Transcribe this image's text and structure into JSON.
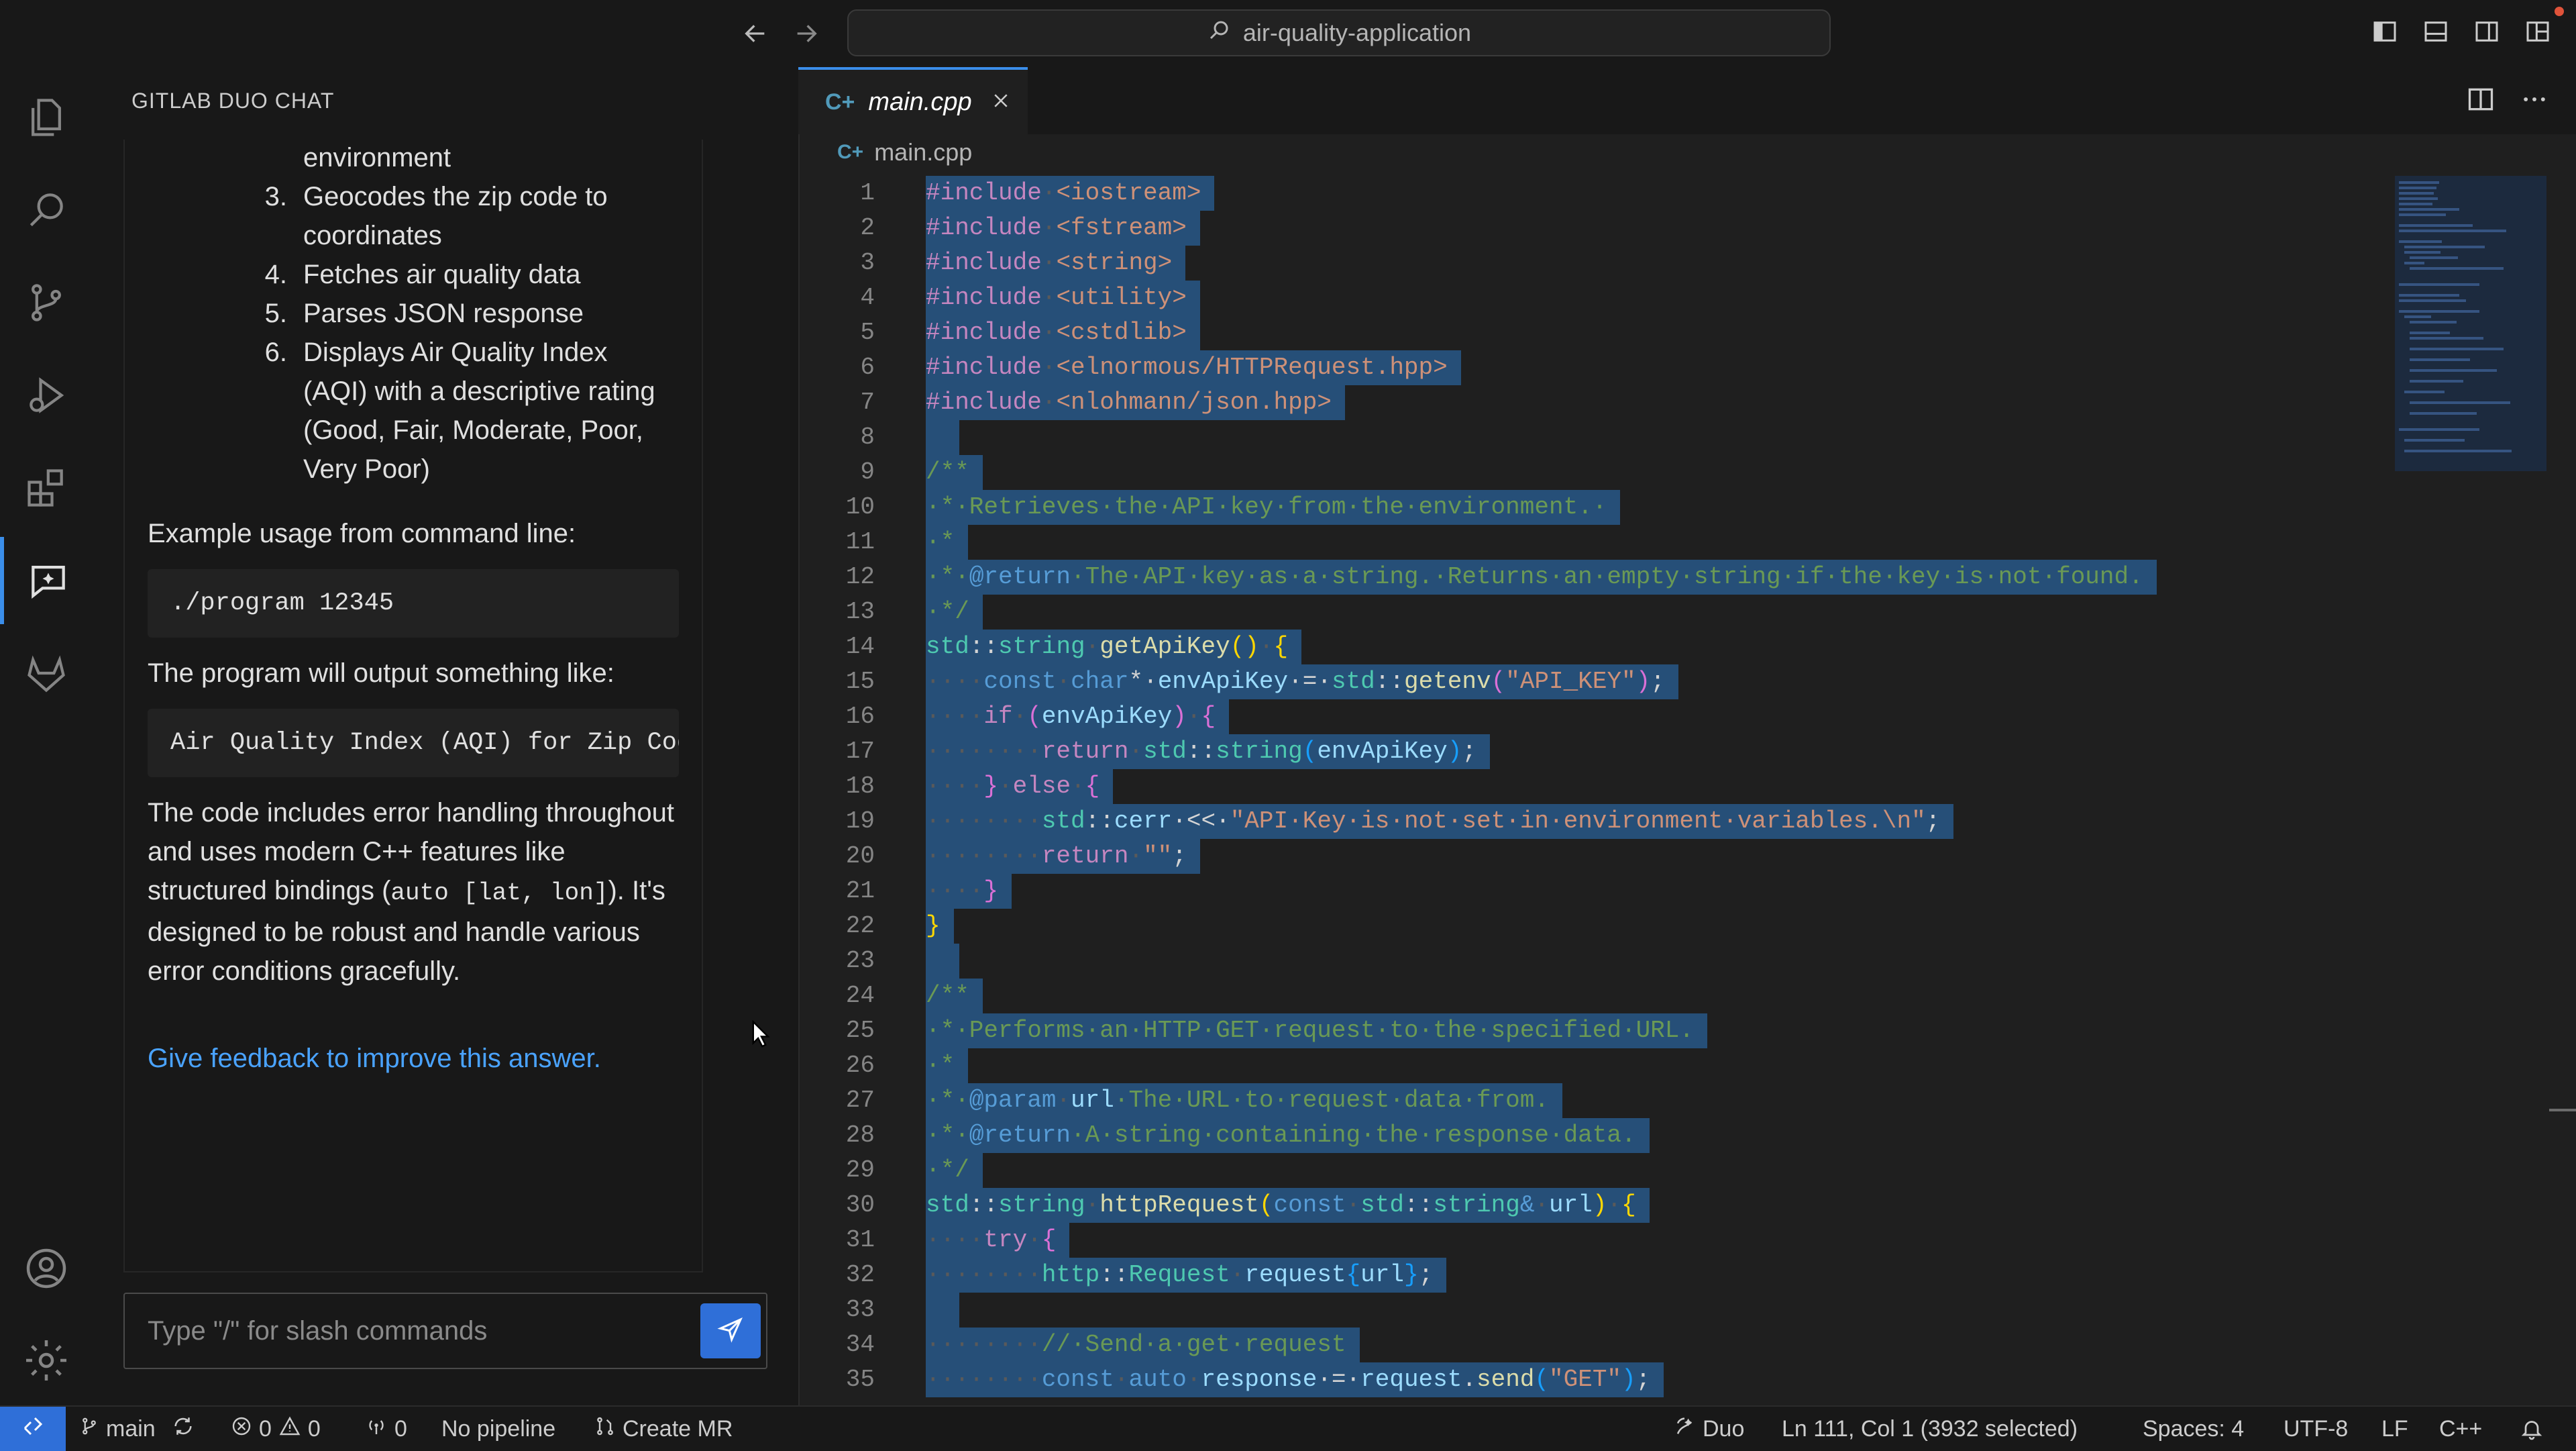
{
  "titlebar": {
    "search_text": "air-quality-application",
    "back": "back-arrow",
    "forward": "forward-arrow"
  },
  "activity_bar": {
    "items": [
      "explorer",
      "search",
      "source-control",
      "run-debug",
      "extensions",
      "gitlab-duo-chat",
      "gitlab"
    ],
    "bottom": [
      "accounts",
      "manage"
    ],
    "active": "gitlab-duo-chat"
  },
  "chat": {
    "title": "GITLAB DUO CHAT",
    "list_partial": "environment",
    "list_items": [
      {
        "num": "3.",
        "text": "Geocodes the zip code to coordinates"
      },
      {
        "num": "4.",
        "text": "Fetches air quality data"
      },
      {
        "num": "5.",
        "text": "Parses JSON response"
      },
      {
        "num": "6.",
        "text": "Displays Air Quality Index (AQI) with a descriptive rating (Good, Fair, Moderate, Poor, Very Poor)"
      }
    ],
    "usage_heading": "Example usage from command line:",
    "usage_code": "./program 12345",
    "output_heading": "The program will output something like:",
    "output_code": "Air Quality Index (AQI) for Zip Code",
    "summary_1": "The code includes error handling throughout and uses modern C++ features like structured bindings (",
    "summary_code": "auto [lat, lon]",
    "summary_2": "). It's designed to be robust and handle various error conditions gracefully.",
    "feedback_link": "Give feedback to improve this answer.",
    "input_placeholder": "Type \"/\" for slash commands"
  },
  "editor": {
    "tab_label": "main.cpp",
    "breadcrumb": "main.cpp",
    "line_numbers": [
      "1",
      "2",
      "3",
      "4",
      "5",
      "6",
      "7",
      "8",
      "9",
      "10",
      "11",
      "12",
      "13",
      "14",
      "15",
      "16",
      "17",
      "18",
      "19",
      "20",
      "21",
      "22",
      "23",
      "24",
      "25",
      "26",
      "27",
      "28",
      "29",
      "30",
      "31",
      "32",
      "33",
      "34",
      "35"
    ]
  },
  "statusbar": {
    "branch": "main",
    "errors": "0",
    "warnings": "0",
    "ports": "0",
    "pipeline": "No pipeline",
    "create_mr": "Create MR",
    "duo": "Duo",
    "position": "Ln 111, Col 1 (3932 selected)",
    "spaces": "Spaces: 4",
    "encoding": "UTF-8",
    "eol": "LF",
    "language": "C++"
  },
  "colors": {
    "accent": "#3b8eea",
    "selection": "#264f78",
    "link": "#4aa3ff",
    "background": "#1f1f1f"
  }
}
